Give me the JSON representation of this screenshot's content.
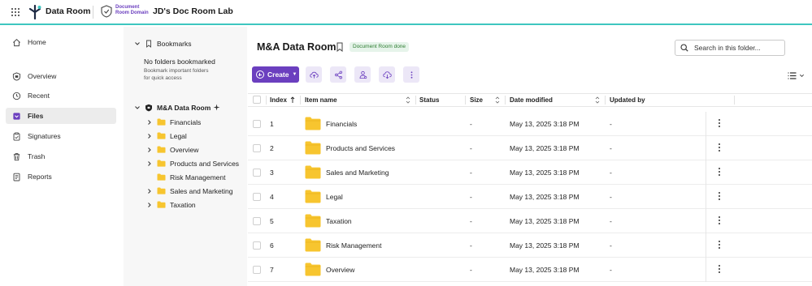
{
  "header": {
    "app_name": "Data Room",
    "domain_tag_line1": "Document",
    "domain_tag_line2": "Room Domain",
    "workspace_name": "JD's Doc Room Lab",
    "accent_color": "#3ec6c0",
    "brand_color": "#6b3fbf"
  },
  "nav": {
    "items": [
      {
        "label": "Home",
        "icon": "home-icon"
      },
      {
        "label": "Overview",
        "icon": "overview-icon"
      },
      {
        "label": "Recent",
        "icon": "clock-icon"
      },
      {
        "label": "Files",
        "icon": "files-icon",
        "active": true
      },
      {
        "label": "Signatures",
        "icon": "clipboard-icon"
      },
      {
        "label": "Trash",
        "icon": "trash-icon"
      },
      {
        "label": "Reports",
        "icon": "reports-icon"
      }
    ]
  },
  "tree": {
    "bookmarks_label": "Bookmarks",
    "bookmarks_empty": "No folders bookmarked",
    "bookmarks_hint_line1": "Bookmark important folders",
    "bookmarks_hint_line2": "for quick access",
    "root_label": "M&A Data Room",
    "folders": [
      {
        "label": "Financials",
        "expandable": true
      },
      {
        "label": "Legal",
        "expandable": true
      },
      {
        "label": "Overview",
        "expandable": true
      },
      {
        "label": "Products and Services",
        "expandable": true
      },
      {
        "label": "Risk Management",
        "expandable": false
      },
      {
        "label": "Sales and Marketing",
        "expandable": true
      },
      {
        "label": "Taxation",
        "expandable": true
      }
    ]
  },
  "main": {
    "title": "M&A Data Room",
    "status_badge": "Document Room done",
    "search_placeholder": "Search in this folder...",
    "create_label": "Create",
    "columns": {
      "index": "Index",
      "item_name": "Item name",
      "status": "Status",
      "size": "Size",
      "date_modified": "Date modified",
      "updated_by": "Updated by"
    },
    "rows": [
      {
        "index": "1",
        "name": "Financials",
        "size": "-",
        "date": "May 13, 2025 3:18 PM",
        "updated_by": "-"
      },
      {
        "index": "2",
        "name": "Products and Services",
        "size": "-",
        "date": "May 13, 2025 3:18 PM",
        "updated_by": "-"
      },
      {
        "index": "3",
        "name": "Sales and Marketing",
        "size": "-",
        "date": "May 13, 2025 3:18 PM",
        "updated_by": "-"
      },
      {
        "index": "4",
        "name": "Legal",
        "size": "-",
        "date": "May 13, 2025 3:18 PM",
        "updated_by": "-"
      },
      {
        "index": "5",
        "name": "Taxation",
        "size": "-",
        "date": "May 13, 2025 3:18 PM",
        "updated_by": "-"
      },
      {
        "index": "6",
        "name": "Risk Management",
        "size": "-",
        "date": "May 13, 2025 3:18 PM",
        "updated_by": "-"
      },
      {
        "index": "7",
        "name": "Overview",
        "size": "-",
        "date": "May 13, 2025 3:18 PM",
        "updated_by": "-"
      }
    ]
  }
}
